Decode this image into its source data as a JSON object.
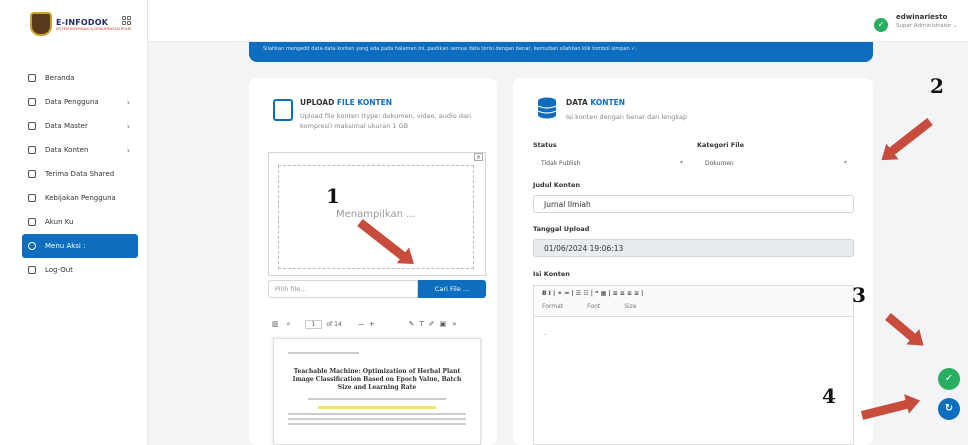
{
  "brand": {
    "name": "E-INFODOK",
    "tagline": "SISTEM INFORMASI & DOKUMENTASI POLRI"
  },
  "header": {
    "user_name": "edwinariesto",
    "user_role": "Super Administrator ⌄"
  },
  "sidebar": {
    "items": [
      {
        "label": "Beranda",
        "has_chevron": false,
        "icon": "home-icon"
      },
      {
        "label": "Data Pengguna",
        "has_chevron": true,
        "icon": "users-icon"
      },
      {
        "label": "Data Master",
        "has_chevron": true,
        "icon": "database-icon"
      },
      {
        "label": "Data Konten",
        "has_chevron": true,
        "icon": "content-icon"
      },
      {
        "label": "Terima Data Shared",
        "has_chevron": false,
        "icon": "download-icon"
      },
      {
        "label": "Kebijakan Pengguna",
        "has_chevron": false,
        "icon": "help-icon"
      },
      {
        "label": "Akun Ku",
        "has_chevron": false,
        "icon": "user-icon"
      },
      {
        "label": "Menu Aksi :",
        "has_chevron": false,
        "icon": "action-icon",
        "active": true
      },
      {
        "label": "Log-Out",
        "has_chevron": false,
        "icon": "logout-icon"
      }
    ],
    "chevron": "›"
  },
  "banner": {
    "text": "Silahkan mengedit data-data konten yang ada pada halaman ini, pastikan semua data terisi dengan benar, kemudian silahkan klik tombol simpan ✓."
  },
  "upload": {
    "title_prefix": "UPLOAD ",
    "title_highlight": "FILE KONTEN",
    "subtitle": "Upload file konten (type: dokumen, video, audio dan kompresi) maksimal ukuran 1 GB",
    "preview_text": "Menampilkan ...",
    "close": "×",
    "file_placeholder": "Pilih file...",
    "browse_label": "Cari File ...",
    "pdf_page": "1",
    "pdf_total": "of 14",
    "pdf_zoom_minus": "—",
    "pdf_zoom_plus": "+",
    "pdf_more": "»",
    "pdf_title": "Teachable Machine: Optimization of Herbal Plant Image Classification Based on Epoch Value, Batch Size and Learning Rate"
  },
  "data_konten": {
    "title_prefix": "DATA ",
    "title_highlight": "KONTEN",
    "subtitle": "Isi konten dengan benar dan lengkap",
    "status_label": "Status",
    "status_value": "Tidak Publish",
    "kategori_label": "Kategori File",
    "kategori_value": "Dokumen",
    "judul_label": "Judul Konten",
    "judul_value": "Jurnal Ilmiah",
    "tanggal_label": "Tanggal Upload",
    "tanggal_value": "01/06/2024 19:06:13",
    "isi_label": "Isi Konten",
    "editor_buttons": "B   I  |  ⚭  ⚮  |  ☰  ☷  |  ❝  ▦  |  ≡  ≡  ≡  ≡  |",
    "editor_format": "Format",
    "editor_font": "Font",
    "editor_size": "Size",
    "editor_body_char": "-"
  },
  "annotations": {
    "n1": "1",
    "n2": "2",
    "n3": "3",
    "n4": "4"
  },
  "actions": {
    "save_icon": "✓",
    "reset_icon": "↻"
  },
  "colors": {
    "primary": "#0d6ebf",
    "save": "#27ae60",
    "reset": "#0d6ebf",
    "arrow": "#c84c3c"
  }
}
